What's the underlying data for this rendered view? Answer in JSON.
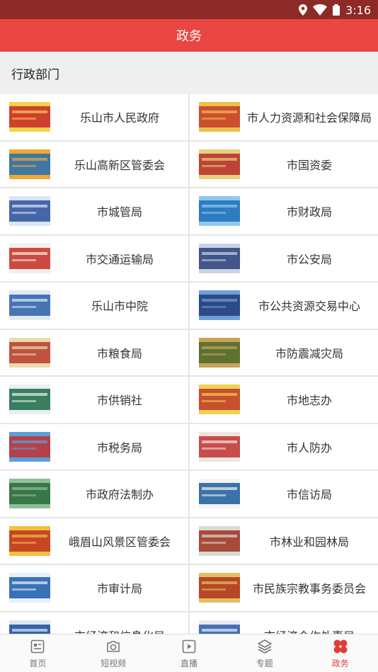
{
  "status_bar": {
    "time": "3:16"
  },
  "header": {
    "title": "政务"
  },
  "section": {
    "title": "行政部门"
  },
  "departments": [
    {
      "name": "乐山市人民政府"
    },
    {
      "name": "市人力资源和社会保障局"
    },
    {
      "name": "乐山高新区管委会"
    },
    {
      "name": "市国资委"
    },
    {
      "name": "市城管局"
    },
    {
      "name": "市财政局"
    },
    {
      "name": "市交通运输局"
    },
    {
      "name": "市公安局"
    },
    {
      "name": "乐山市中院"
    },
    {
      "name": "市公共资源交易中心"
    },
    {
      "name": "市粮食局"
    },
    {
      "name": "市防震减灾局"
    },
    {
      "name": "市供销社"
    },
    {
      "name": "市地志办"
    },
    {
      "name": "市税务局"
    },
    {
      "name": "市人防办"
    },
    {
      "name": "市政府法制办"
    },
    {
      "name": "市信访局"
    },
    {
      "name": "峨眉山风景区管委会"
    },
    {
      "name": "市林业和园林局"
    },
    {
      "name": "市审计局"
    },
    {
      "name": "市民族宗教事务委员会"
    },
    {
      "name": "市经济和信息化局"
    },
    {
      "name": "市经济合作外事局"
    }
  ],
  "tabs": [
    {
      "label": "首页",
      "icon": "news-icon"
    },
    {
      "label": "短视频",
      "icon": "camera-icon"
    },
    {
      "label": "直播",
      "icon": "play-icon"
    },
    {
      "label": "专题",
      "icon": "layers-icon"
    },
    {
      "label": "政务",
      "icon": "clover-icon",
      "active": true
    }
  ],
  "colors": {
    "status_bar": "#8c2a27",
    "header": "#e94642",
    "active_tab": "#e63c38"
  }
}
